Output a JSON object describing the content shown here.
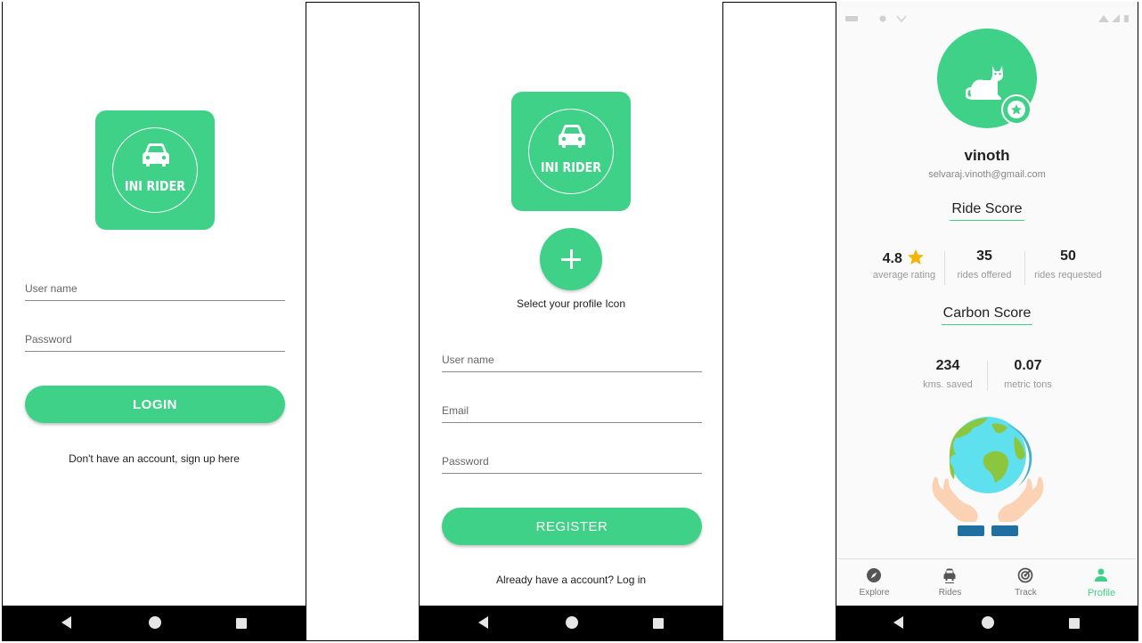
{
  "login_screen": {
    "brand": "INI RIDER",
    "username_placeholder": "User name",
    "password_placeholder": "Password",
    "login_label": "LOGIN",
    "signup_link": "Don't have an account, sign up here"
  },
  "register_screen": {
    "brand": "INI RIDER",
    "select_icon_hint": "Select your profile Icon",
    "username_placeholder": "User name",
    "email_placeholder": "Email",
    "password_placeholder": "Password",
    "register_label": "REGISTER",
    "login_link": "Already have a account? Log in"
  },
  "profile_screen": {
    "user_name": "vinoth",
    "email": "selvaraj.vinoth@gmail.com",
    "ride_score": {
      "title": "Ride Score",
      "rating_value": "4.8",
      "rating_label": "average rating",
      "offered_value": "35",
      "offered_label": "rides offered",
      "requested_value": "50",
      "requested_label": "rides requested"
    },
    "carbon_score": {
      "title": "Carbon Score",
      "kms_value": "234",
      "kms_label": "kms. saved",
      "tons_value": "0.07",
      "tons_label": "metric tons"
    },
    "tabs": [
      {
        "label": "Explore",
        "icon": "compass-icon"
      },
      {
        "label": "Rides",
        "icon": "car-icon"
      },
      {
        "label": "Track",
        "icon": "target-icon"
      },
      {
        "label": "Profile",
        "icon": "person-icon",
        "active": true
      }
    ]
  },
  "colors": {
    "accent": "#40d188",
    "star": "#f5b400",
    "navbar": "#000000"
  }
}
